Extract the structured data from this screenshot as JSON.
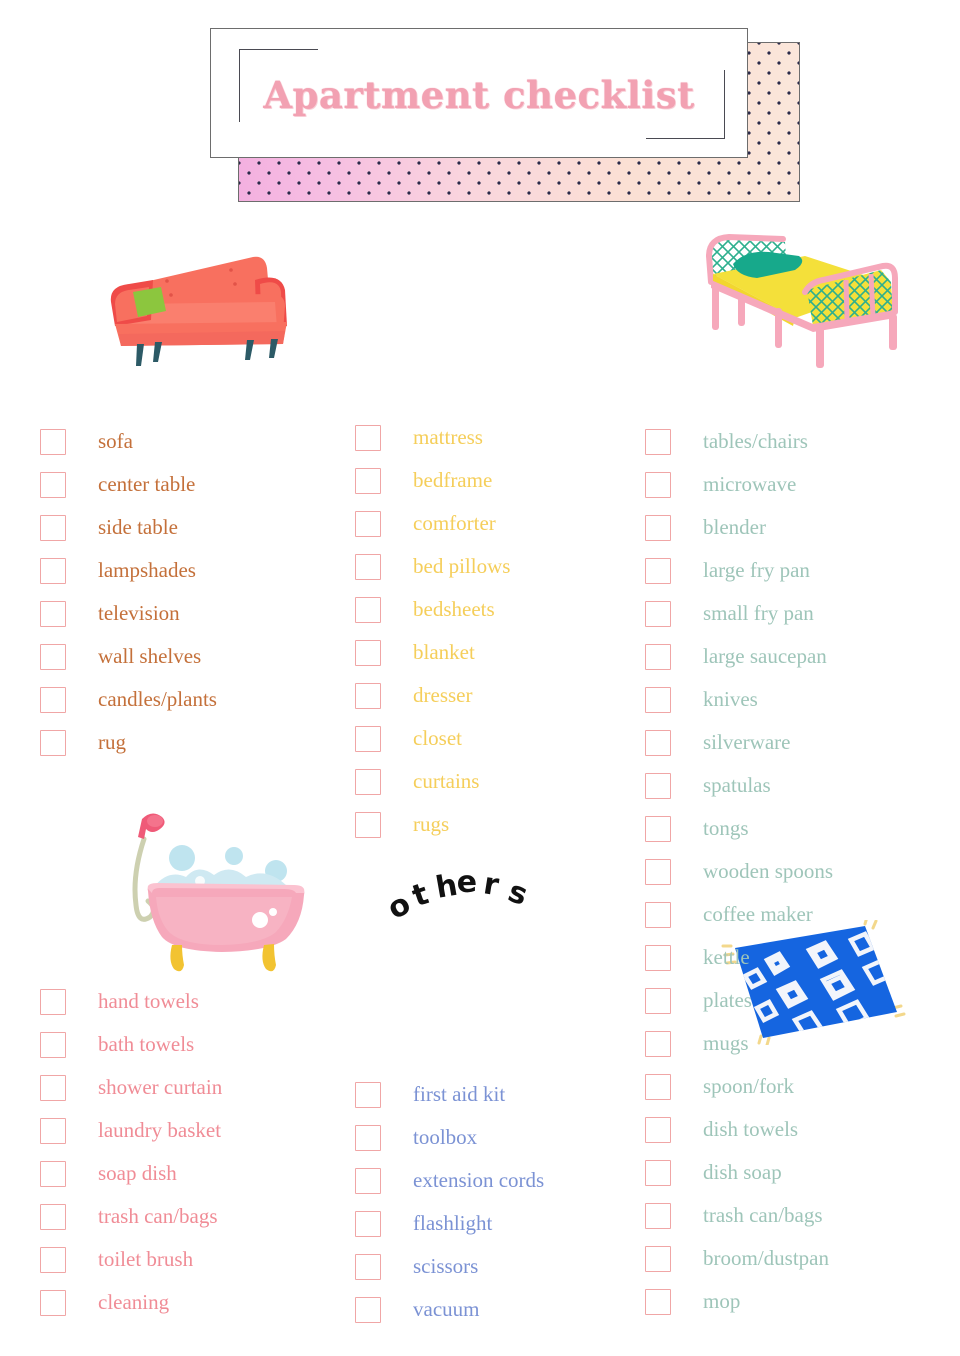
{
  "title": {
    "text": "Apartment checklist"
  },
  "others_heading": {
    "text": "others",
    "letters": [
      "o",
      "t",
      "h",
      "e",
      "r",
      "s"
    ]
  },
  "colors": {
    "living_text": "#c4703a",
    "bedroom_text": "#f5ce5a",
    "kitchen_text": "#9ec5b9",
    "bathroom_text": "#f08c96",
    "others_text": "#7b92d4",
    "checkbox_border": "#f0a6a6",
    "title_text": "#f2a1b2",
    "frame_border": "#6d6d6d"
  },
  "illustrations": {
    "sofa": "sofa-illustration",
    "bed": "bed-illustration",
    "kitchen": "kitchen-illustration",
    "bathtub": "bathtub-illustration",
    "rug": "rug-illustration"
  },
  "sections": {
    "living_room": {
      "items": [
        "sofa",
        "center table",
        "side table",
        "lampshades",
        "television",
        "wall shelves",
        "candles/plants",
        "rug"
      ]
    },
    "bedroom": {
      "items": [
        "mattress",
        "bedframe",
        "comforter",
        "bed pillows",
        "bedsheets",
        "blanket",
        "dresser",
        "closet",
        "curtains",
        "rugs"
      ]
    },
    "kitchen": {
      "items": [
        "tables/chairs",
        "microwave",
        "blender",
        "large fry pan",
        "small fry pan",
        "large saucepan",
        "knives",
        "silverware",
        "spatulas",
        "tongs",
        "wooden spoons",
        "coffee maker",
        "kettle",
        "plates",
        "mugs",
        "spoon/fork",
        "dish towels",
        "dish soap",
        "trash can/bags",
        "broom/dustpan",
        "mop"
      ]
    },
    "bathroom": {
      "items": [
        "hand towels",
        "bath towels",
        "shower curtain",
        "laundry basket",
        "soap dish",
        "trash can/bags",
        "toilet brush",
        "cleaning"
      ]
    },
    "others": {
      "items": [
        "first aid kit",
        "toolbox",
        "extension cords",
        "flashlight",
        "scissors",
        "vacuum"
      ]
    }
  }
}
